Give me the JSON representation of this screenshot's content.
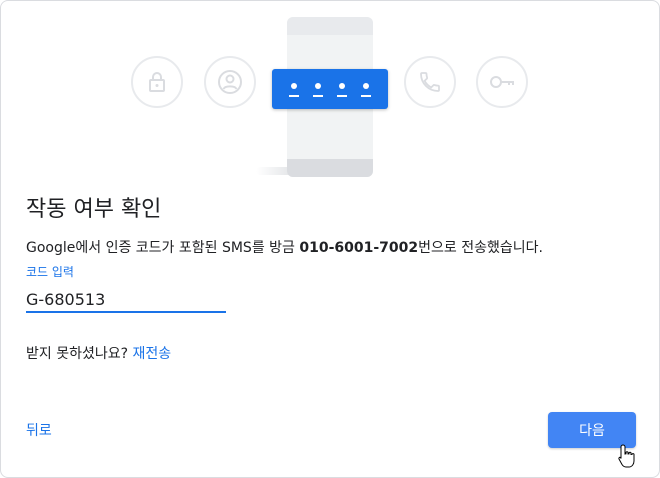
{
  "colors": {
    "accent": "#1a73e8",
    "button": "#4285f4",
    "text": "#202124",
    "icon_gray": "#e8eaed"
  },
  "illustration": {
    "icons": [
      "lock-icon",
      "account-icon",
      "phone-call-icon",
      "key-icon"
    ],
    "code_dots": 4
  },
  "title": "작동 여부 확인",
  "description": {
    "prefix": "Google에서 인증 코드가 포함된 SMS를 방금 ",
    "phone": "010-6001-7002",
    "suffix": "번으로 전송했습니다."
  },
  "code_field": {
    "label": "코드 입력",
    "value": "G-680513"
  },
  "resend": {
    "question": "받지 못하셨나요? ",
    "link": "재전송"
  },
  "footer": {
    "back_label": "뒤로",
    "next_label": "다음"
  }
}
